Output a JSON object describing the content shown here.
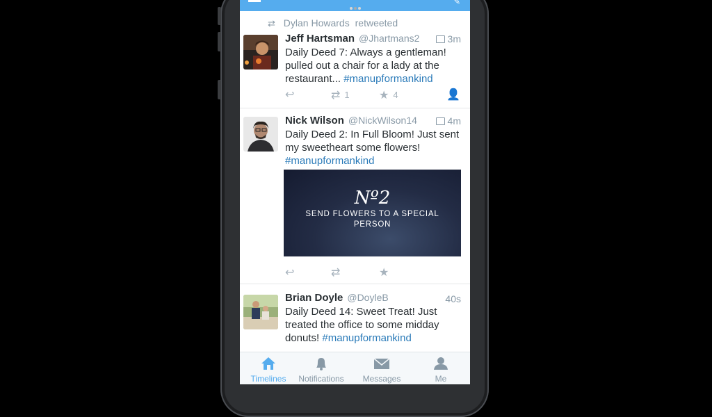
{
  "accent_color": "#55acee",
  "link_color": "#2b7bb9",
  "retweet_context": {
    "user": "Dylan Howards",
    "action": "retweeted",
    "icon": "retweet-icon"
  },
  "tweets": [
    {
      "name": "Jeff Hartsman",
      "handle": "@Jhartmans2",
      "time": "3m",
      "text": "Daily Deed 7: Always a gentleman! pulled out a chair for a lady at the restaurant...",
      "hashtag": "#manupformankind",
      "retweets": "1",
      "favorites": "4"
    },
    {
      "name": "Nick Wilson",
      "handle": "@NickWilson14",
      "time": "4m",
      "text": "Daily Deed 2: In Full Bloom! Just sent my sweetheart some flowers!",
      "hashtag": "#manupformankind",
      "media": {
        "number": "Nº2",
        "caption": "SEND FLOWERS TO A SPECIAL PERSON"
      }
    },
    {
      "name": "Brian Doyle",
      "handle": "@DoyleB",
      "time": "40s",
      "text": "Daily Deed 14: Sweet Treat! Just treated the office to some midday donuts!",
      "hashtag": "#manupformankind"
    }
  ],
  "tabs": [
    {
      "label": "Timelines",
      "icon": "home-icon",
      "active": true
    },
    {
      "label": "Notifications",
      "icon": "bell-icon"
    },
    {
      "label": "Messages",
      "icon": "envelope-icon"
    },
    {
      "label": "Me",
      "icon": "person-icon"
    }
  ]
}
